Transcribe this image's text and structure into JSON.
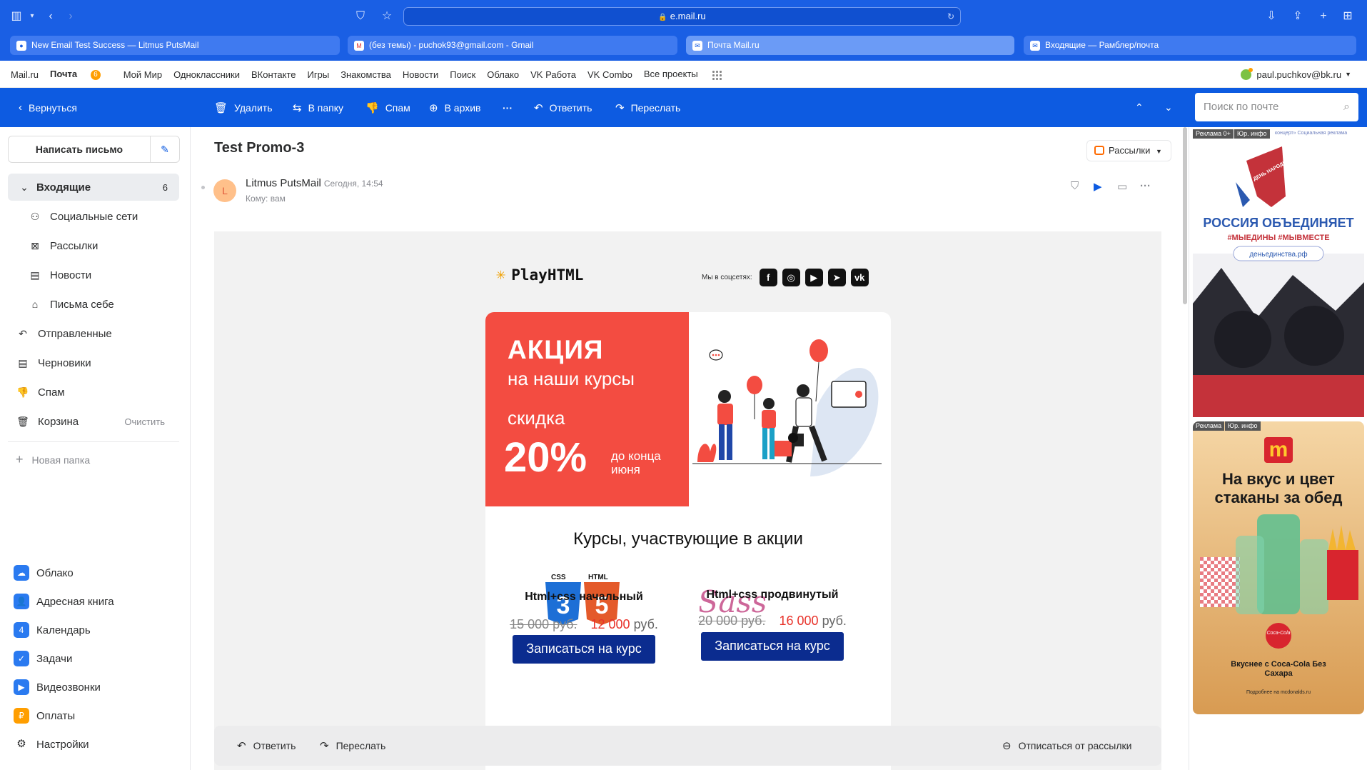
{
  "browser": {
    "url": "e.mail.ru",
    "tabs": [
      {
        "label": "New Email Test Success — Litmus PutsMail"
      },
      {
        "label": "(без темы) - puchok93@gmail.com - Gmail"
      },
      {
        "label": "Почта Mail.ru"
      },
      {
        "label": "Входящие — Рамблер/почта"
      }
    ]
  },
  "portal": {
    "links": [
      "Mail.ru",
      "Почта",
      "Мой Мир",
      "Одноклассники",
      "ВКонтакте",
      "Игры",
      "Знакомства",
      "Новости",
      "Поиск",
      "Облако",
      "VK Работа",
      "VK Combo",
      "Все проекты"
    ],
    "mail_badge": "6",
    "user_email": "paul.puchkov@bk.ru"
  },
  "toolbar": {
    "back": "Вернуться",
    "delete": "Удалить",
    "move": "В папку",
    "spam": "Спам",
    "archive": "В архив",
    "more": "···",
    "reply": "Ответить",
    "forward": "Переслать",
    "search_placeholder": "Поиск по почте"
  },
  "sidebar": {
    "compose": "Написать письмо",
    "folders": {
      "inbox": {
        "label": "Входящие",
        "count": "6"
      },
      "social": "Социальные сети",
      "newsletters": "Рассылки",
      "news": "Новости",
      "self": "Письма себе",
      "sent": "Отправленные",
      "drafts": "Черновики",
      "spam": "Спам",
      "trash": "Корзина",
      "trash_clear": "Очистить"
    },
    "new_folder": "Новая папка",
    "apps": [
      "Облако",
      "Адресная книга",
      "Календарь",
      "Задачи",
      "Видеозвонки",
      "Оплаты",
      "Настройки"
    ]
  },
  "message": {
    "subject": "Test Promo-3",
    "category": "Рассылки",
    "sender_initial": "L",
    "sender": "Litmus PutsMail",
    "date": "Сегодня, 14:54",
    "to": "Кому: вам"
  },
  "email": {
    "brand": "PlayHTML",
    "social_label": "Мы в соцсетях:",
    "promo": {
      "line1": "АКЦИЯ",
      "line2": "на наши курсы",
      "line3": "скидка",
      "discount": "20%",
      "until": "до конца июня"
    },
    "courses_title": "Курсы, участвующие в акции",
    "courses": [
      {
        "name": "Html+css начальный",
        "old_price": "15 000 руб.",
        "new_price": "12 000",
        "currency": "руб.",
        "button": "Записаться на курс",
        "logo_labels": [
          "CSS",
          "HTML"
        ]
      },
      {
        "name": "Html+css продвинутый",
        "old_price": "20 000 руб.",
        "new_price": "16 000",
        "currency": "руб.",
        "button": "Записаться на курс",
        "logo_labels": [
          "Sass"
        ]
      }
    ]
  },
  "bottom_bar": {
    "reply": "Ответить",
    "forward": "Переслать",
    "unsubscribe": "Отписаться от рассылки"
  },
  "ads": {
    "ad1": {
      "tags": [
        "Реклама 0+",
        "Юр. инфо"
      ],
      "header": "концерт» Социальная реклама",
      "badge": "ДЕНЬ НАРОДНОГО ЕДИНСТВА 4 НОЯБРЯ",
      "headline": "РОССИЯ ОБЪЕДИНЯЕТ",
      "hashtags": "#МЫЕДИНЫ #МЫВМЕСТЕ",
      "link": "деньединства.рф"
    },
    "ad2": {
      "tags": [
        "Реклама",
        "Юр. инфо"
      ],
      "headline": "На вкус и цвет стаканы за обед",
      "coke_logo": "Coca-Cola",
      "subline": "Вкуснее с Coca-Cola Без Сахара",
      "footer": "Подробнее на mcdonalds.ru"
    }
  },
  "colors": {
    "brand_blue": "#0d5be1",
    "promo_red": "#f34c41",
    "button_navy": "#0b2c8f",
    "price_red": "#e8322a"
  }
}
